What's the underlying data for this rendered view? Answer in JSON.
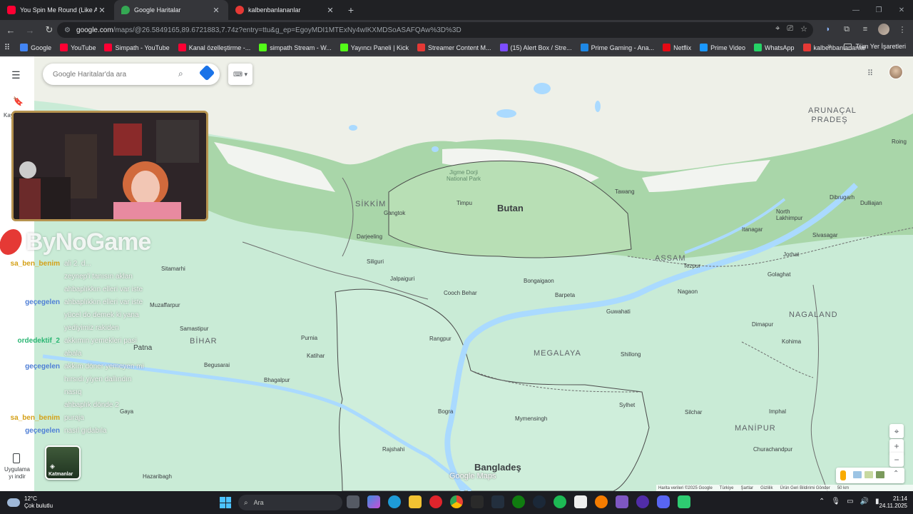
{
  "tabs": [
    {
      "title": "You Spin Me Round (Like A Rec",
      "favicon_color": "#ff0033",
      "active": false
    },
    {
      "title": "Google Haritalar",
      "favicon_color": "#34a853",
      "active": true
    },
    {
      "title": "kalbenbanlananlar",
      "favicon_color": "#e53935",
      "active": false
    }
  ],
  "toolbar": {
    "url_host": "google.com",
    "url_path": "/maps/@26.5849165,89.6721883,7.74z?entry=ttu&g_ep=EgoyMDI1MTExNy4wIKXMDSoASAFQAw%3D%3D"
  },
  "bookmarks": [
    {
      "label": "Google",
      "color": "#4285f4"
    },
    {
      "label": "YouTube",
      "color": "#ff0033"
    },
    {
      "label": "Simpath - YouTube",
      "color": "#ff0033"
    },
    {
      "label": "Kanal özelleştirme -...",
      "color": "#ff0033"
    },
    {
      "label": "simpath Stream - W...",
      "color": "#53fc18"
    },
    {
      "label": "Yayıncı Paneli | Kick",
      "color": "#53fc18"
    },
    {
      "label": "Streamer Content M...",
      "color": "#e53935"
    },
    {
      "label": "(15) Alert Box / Stre...",
      "color": "#7c4dff"
    },
    {
      "label": "Prime Gaming - Ana...",
      "color": "#1e88e5"
    },
    {
      "label": "Netflix",
      "color": "#e50914"
    },
    {
      "label": "Prime Video",
      "color": "#1a98ff"
    },
    {
      "label": "WhatsApp",
      "color": "#25d366"
    },
    {
      "label": "kalbenbanlananlar",
      "color": "#e53935"
    }
  ],
  "bookmarks_all": "Tüm Yer İşaretleri",
  "maps": {
    "search_placeholder": "Google Haritalar'da ara",
    "rail_saved": "Kay",
    "rail_app_label": "Uygulama yı indir",
    "layers_label": "Katmanlar",
    "logo": "Google Maps",
    "attribution": [
      "Harita verileri ©2025 Google",
      "Türkiye",
      "Şartlar",
      "Gizlilik",
      "Ürün Geri Bildirimi Gönder",
      "50 km"
    ]
  },
  "map_labels": {
    "butan": "Butan",
    "bangladesh": "Bangladeş",
    "sikkim": "SİKKİM",
    "assam": "ASSAM",
    "megalaya": "MEGALAYA",
    "nagaland": "NAGALAND",
    "manipur": "MANİPUR",
    "bihar": "BİHAR",
    "arunacal": "ARUNAÇAL PRADEŞ",
    "jigme": "Jigme Dorji National Park",
    "timpu": "Timpu",
    "gangtok": "Gangtok",
    "darjeeling": "Darjeeling",
    "siliguri": "Siliguri",
    "jalpaiguri": "Jalpaiguri",
    "cooch": "Cooch Behar",
    "bongaigaon": "Bongaigaon",
    "barpeta": "Barpeta",
    "guwahati": "Guwahati",
    "nagaon": "Nagaon",
    "tezpur": "Tezpur",
    "jorhat": "Jorhat",
    "golaghat": "Golaghat",
    "dimapur": "Dimapur",
    "kohima": "Kohima",
    "imphal": "Imphal",
    "churachandpur": "Churachandpur",
    "silchar": "Silchar",
    "sylhet": "Sylhet",
    "shillong": "Shillong",
    "mymensingh": "Mymensingh",
    "bogra": "Bogra",
    "rangpur": "Rangpur",
    "rajshahi": "Rajshahi",
    "purnia": "Purnia",
    "katihar": "Katihar",
    "bhagalpur": "Bhagalpur",
    "begusarai": "Begusarai",
    "samastipur": "Samastipur",
    "patna": "Patna",
    "gaya": "Gaya",
    "muzaffarpur": "Muzaffarpur",
    "sitamarhi": "Sitamarhi",
    "hazaribagh": "Hazaribagh",
    "tawang": "Tawang",
    "dibrugarh": "Dibrugarh",
    "north_lakhimpur": "North Lakhimpur",
    "sivasagar": "Sivasagar",
    "itanagar": "Itanagar",
    "roing": "Roing",
    "dulliajan": "Dulliajan"
  },
  "overlay": {
    "brand": "ByNoGame",
    "chat": [
      {
        "user": "sa_ben_benim",
        "color": "#d4a017",
        "msg": "ali 2. d..."
      },
      {
        "user": "",
        "color": "#ffffff",
        "msg": "zeynep'i tanısın aklan"
      },
      {
        "user": "",
        "color": "#ffffff",
        "msg": "ahbaplıkkın elleri var iste"
      },
      {
        "user": "geçegelen",
        "color": "#4f7fd6",
        "msg": "ahbaplıkkın elleri var iste"
      },
      {
        "user": "",
        "color": "#5fbf5f",
        "msg": "yücel do demek ki yana"
      },
      {
        "user": "",
        "color": "#ffffff",
        "msg": "yediyimiz rakiden"
      },
      {
        "user": "ordedektif_2",
        "color": "#2bb673",
        "msg": "akkımın yemekleri pasi"
      },
      {
        "user": "",
        "color": "#ffffff",
        "msg": "abala"
      },
      {
        "user": "geçegelen",
        "color": "#4f7fd6",
        "msg": "akkım döner yemeyen mi"
      },
      {
        "user": "",
        "color": "#ffffff",
        "msg": "hırsıdı yiyen dallındın"
      },
      {
        "user": "",
        "color": "#ffffff",
        "msg": "nasıq"
      },
      {
        "user": "",
        "color": "#5fbf5f",
        "msg": "ahbaplık dönde 2"
      },
      {
        "user": "sa_ben_benim",
        "color": "#d4a017",
        "msg": "puraja"
      },
      {
        "user": "geçegelen",
        "color": "#4f7fd6",
        "msg": "nasıl gıdabıla"
      }
    ]
  },
  "taskbar": {
    "temp": "12°C",
    "weather": "Çok bulutlu",
    "search": "Ara",
    "time": "21:14",
    "date": "24.11.2025"
  },
  "colors": {
    "water": "#aadaff",
    "land_low": "#c9ebd6",
    "mountain": "#a8d4a8",
    "snow": "#f1f3f0",
    "border": "#555555"
  }
}
